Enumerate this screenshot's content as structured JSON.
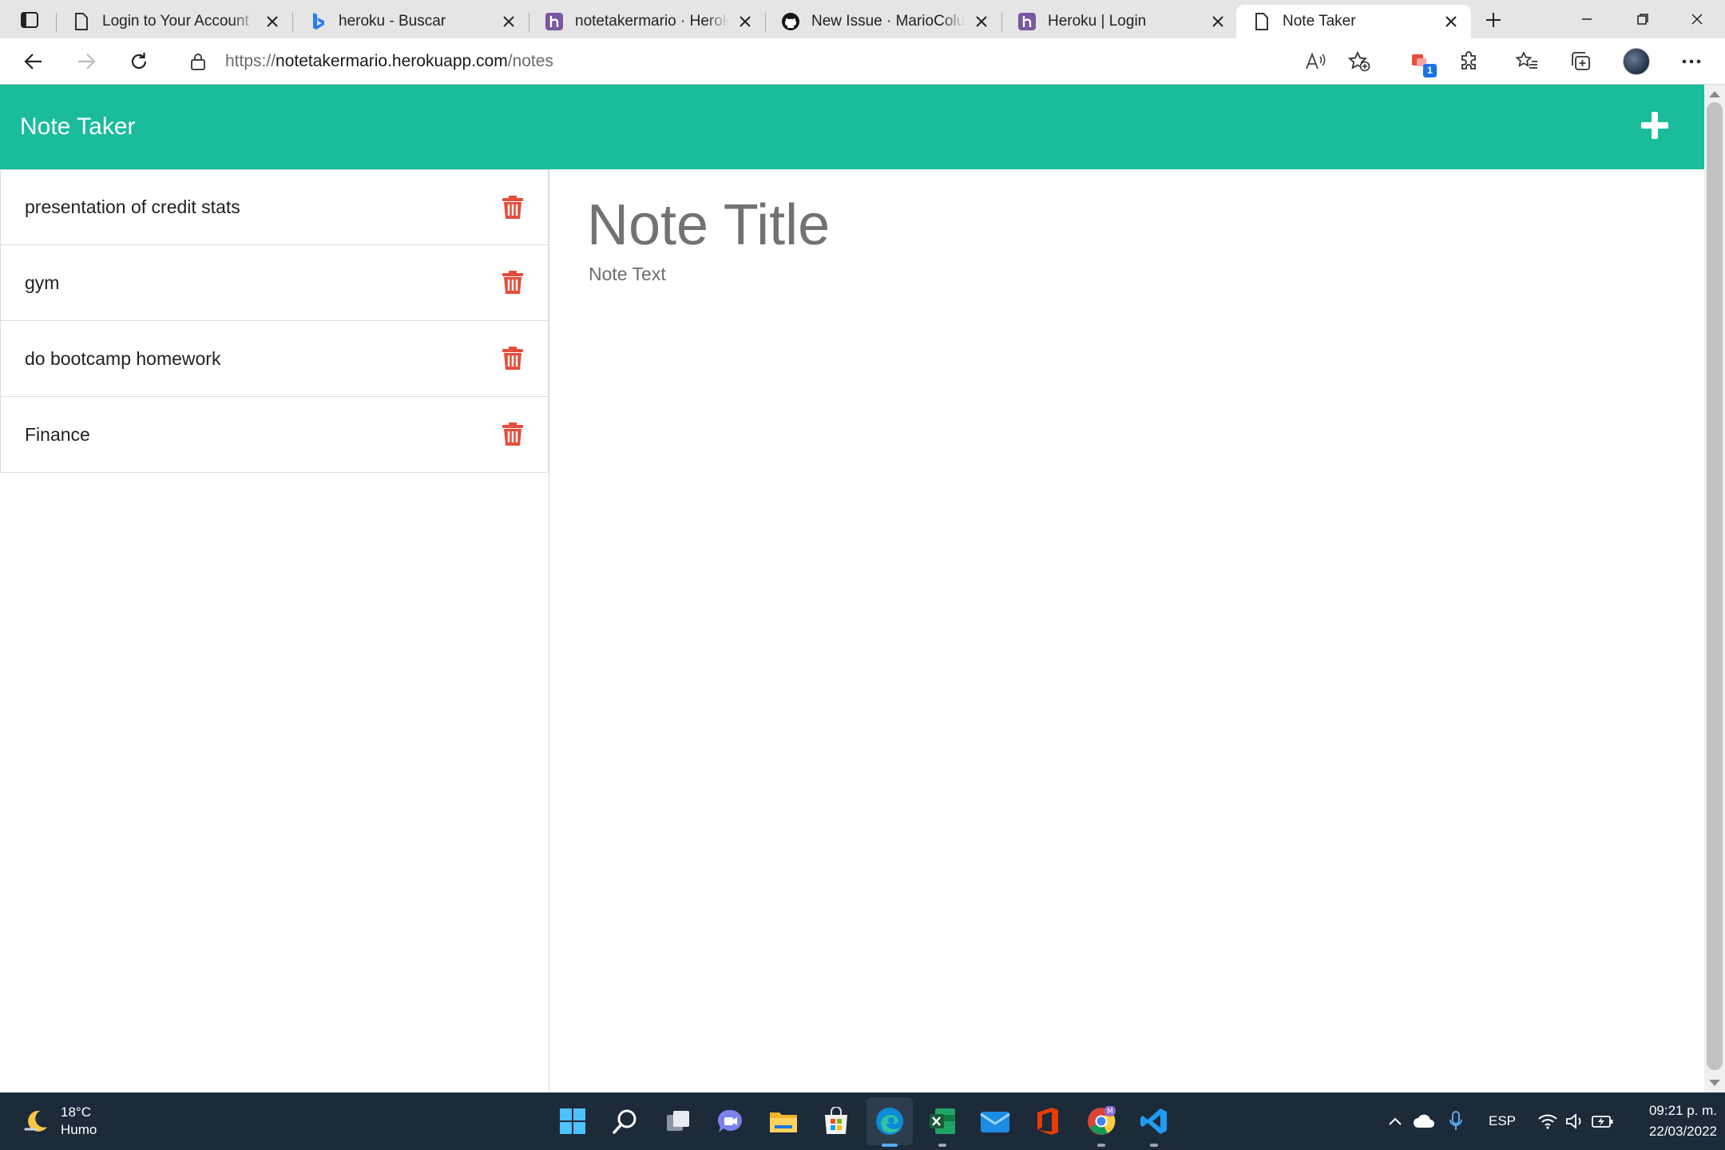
{
  "browser": {
    "tabs": [
      {
        "title": "Login to Your Account | Heroku",
        "icon": "page-icon"
      },
      {
        "title": "heroku - Buscar",
        "icon": "bing-icon"
      },
      {
        "title": "notetakermario · Heroku",
        "icon": "heroku-icon"
      },
      {
        "title": "New Issue · MarioColunga",
        "icon": "github-icon"
      },
      {
        "title": "Heroku | Login",
        "icon": "heroku-icon"
      },
      {
        "title": "Note Taker",
        "icon": "page-icon"
      }
    ],
    "active_tab": 5,
    "url_scheme": "https://",
    "url_host": "notetakermario.herokuapp.com",
    "url_path": "/notes",
    "extension_badge": "1"
  },
  "app": {
    "brand": "Note Taker",
    "accent_color": "#1abc9c",
    "delete_color": "#e74c3c",
    "notes": [
      {
        "title": "presentation of credit stats"
      },
      {
        "title": "gym"
      },
      {
        "title": "do bootcamp homework"
      },
      {
        "title": "Finance"
      }
    ],
    "editor": {
      "title_placeholder": "Note Title",
      "text_placeholder": "Note Text"
    }
  },
  "taskbar": {
    "temperature": "18°C",
    "weather_condition": "Humo",
    "apps": [
      "start-icon",
      "search-icon",
      "task-view-icon",
      "teams-chat-icon",
      "file-explorer-icon",
      "store-icon",
      "edge-icon",
      "excel-icon",
      "mail-icon",
      "office-icon",
      "chrome-icon",
      "vscode-icon"
    ],
    "language": "ESP",
    "time": "09:21 p. m.",
    "date": "22/03/2022"
  }
}
